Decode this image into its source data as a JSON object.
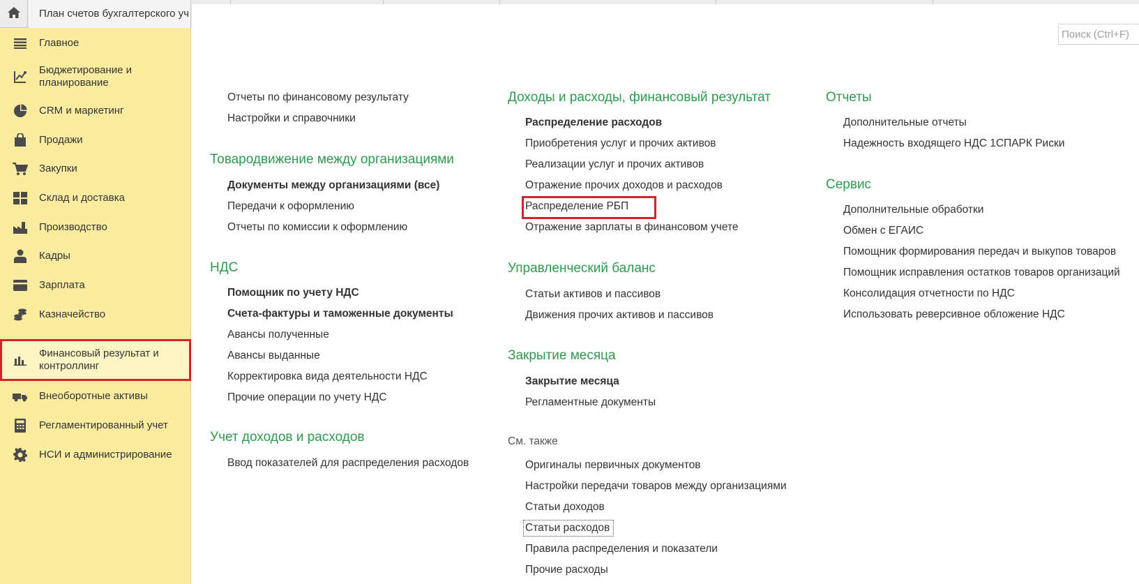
{
  "tabs": {
    "home_icon": "home-icon",
    "active_tab": "План счетов бухгалтерского уч"
  },
  "sidebar": {
    "items": [
      {
        "label": "Главное",
        "icon": "menu-icon"
      },
      {
        "label": "Бюджетирование и планирование",
        "icon": "budget-icon"
      },
      {
        "label": "CRM и маркетинг",
        "icon": "pie-icon"
      },
      {
        "label": "Продажи",
        "icon": "bag-icon"
      },
      {
        "label": "Закупки",
        "icon": "cart-icon"
      },
      {
        "label": "Склад и доставка",
        "icon": "warehouse-icon"
      },
      {
        "label": "Производство",
        "icon": "factory-icon"
      },
      {
        "label": "Кадры",
        "icon": "person-icon"
      },
      {
        "label": "Зарплата",
        "icon": "wallet-icon"
      },
      {
        "label": "Казначейство",
        "icon": "coins-icon"
      },
      {
        "label": "Финансовый результат и контроллинг",
        "icon": "bar-chart-icon",
        "active": true
      },
      {
        "label": "Внеоборотные активы",
        "icon": "truck-icon"
      },
      {
        "label": "Регламентированный учет",
        "icon": "calculator-icon"
      },
      {
        "label": "НСИ и администрирование",
        "icon": "gear-icon"
      }
    ]
  },
  "search": {
    "placeholder": "Поиск (Ctrl+F)"
  },
  "col1": {
    "top_links": [
      "Отчеты по финансовому результату",
      "Настройки и справочники"
    ],
    "sec1": {
      "title": "Товародвижение между организациями",
      "links": [
        "Документы между организациями (все)",
        "Передачи к оформлению",
        "Отчеты по комиссии к оформлению"
      ]
    },
    "sec2": {
      "title": "НДС",
      "links": [
        "Помощник по учету НДС",
        "Счета-фактуры и таможенные документы",
        "Авансы полученные",
        "Авансы выданные",
        "Корректировка вида деятельности НДС",
        "Прочие операции по учету НДС"
      ]
    },
    "sec3": {
      "title": "Учет доходов и расходов",
      "links": [
        "Ввод показателей для распределения расходов"
      ]
    }
  },
  "col2": {
    "sec1": {
      "title": "Доходы и расходы, финансовый результат",
      "links": [
        "Распределение расходов",
        "Приобретения услуг и прочих активов",
        "Реализации услуг и прочих активов",
        "Отражение прочих доходов и расходов",
        "Распределение РБП",
        "Отражение зарплаты в финансовом учете"
      ]
    },
    "sec2": {
      "title": "Управленческий баланс",
      "links": [
        "Статьи активов и пассивов",
        "Движения прочих активов и пассивов"
      ]
    },
    "sec3": {
      "title": "Закрытие месяца",
      "links": [
        "Закрытие месяца",
        "Регламентные документы"
      ]
    },
    "see_also": {
      "title": "См. также",
      "links": [
        "Оригиналы первичных документов",
        "Настройки передачи товаров между организациями",
        "Статьи доходов",
        "Статьи расходов",
        "Правила распределения и показатели",
        "Прочие расходы"
      ]
    }
  },
  "col3": {
    "sec1": {
      "title": "Отчеты",
      "links": [
        "Дополнительные отчеты",
        "Надежность входящего НДС 1СПАРК Риски"
      ]
    },
    "sec2": {
      "title": "Сервис",
      "links": [
        "Дополнительные обработки",
        "Обмен с ЕГАИС",
        "Помощник формирования передач и выкупов товаров",
        "Помощник исправления остатков товаров организаций",
        "Консолидация отчетности по НДС",
        "Использовать реверсивное обложение НДС"
      ]
    }
  },
  "colors": {
    "sidebar_bg": "#fbec9f",
    "section_title": "#2e9a4f",
    "highlight": "#d2222a"
  }
}
